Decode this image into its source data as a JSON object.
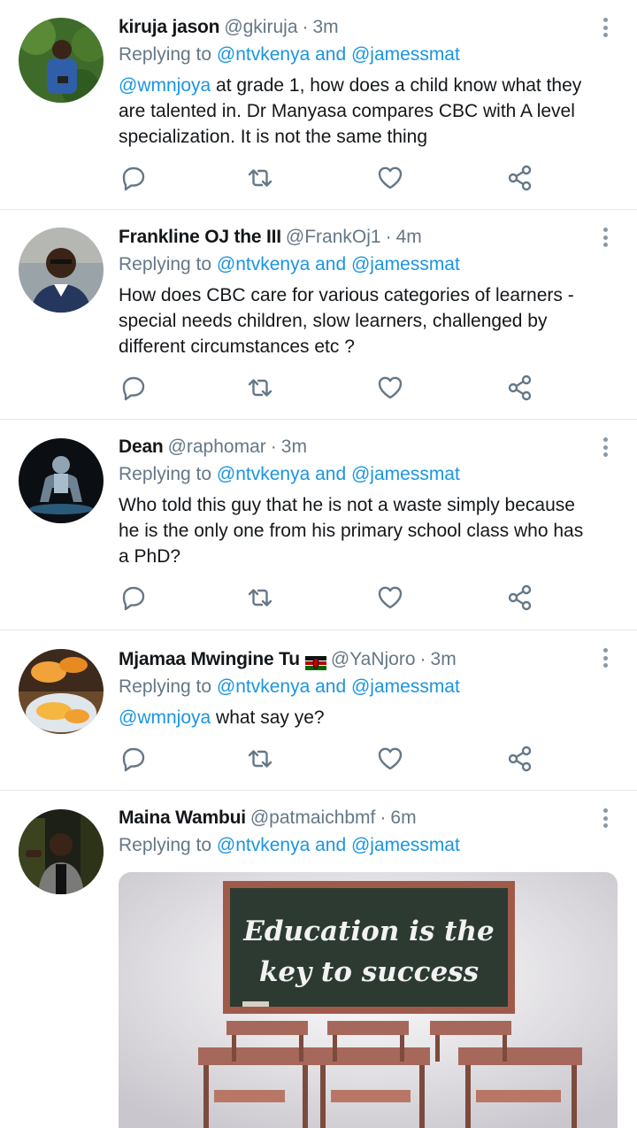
{
  "tweets": [
    {
      "name": "kiruja jason",
      "handle": "@gkiruja",
      "sep": "·",
      "time": "3m",
      "reply_prefix": "Replying to",
      "reply_users": "@ntvkenya and @jamessmat",
      "text_mention": "@wmnjoya",
      "text_lines": [
        "at grade 1, how does a child know what they",
        "are talented in. Dr Manyasa compares CBC with A level",
        "specialization. It is not the same thing"
      ]
    },
    {
      "name": "Frankline OJ the III",
      "handle": "@FrankOj1",
      "sep": "·",
      "time": "4m",
      "reply_prefix": "Replying to",
      "reply_users": "@ntvkenya and @jamessmat",
      "text_lines": [
        "How does CBC care for various categories of learners -",
        "special needs children, slow learners, challenged by",
        "different circumstances etc ?"
      ]
    },
    {
      "name": "Dean",
      "handle": "@raphomar",
      "sep": "·",
      "time": "3m",
      "reply_prefix": "Replying to",
      "reply_users": "@ntvkenya and @jamessmat",
      "text_lines": [
        "Who told this guy that he is not a waste simply because",
        "he is the only one from his primary school class who has",
        "a PhD?"
      ]
    },
    {
      "name": "Mjamaa Mwingine Tu",
      "handle": "@YaNjoro",
      "sep": "·",
      "time": "3m",
      "reply_prefix": "Replying to",
      "reply_users": "@ntvkenya and @jamessmat",
      "text_mention": "@wmnjoya",
      "text_lines": [
        "what say ye?"
      ],
      "flag": "kenya-flag-icon"
    },
    {
      "name": "Maina Wambui",
      "handle": "@patmaichbmf",
      "sep": "·",
      "time": "6m",
      "reply_prefix": "Replying to",
      "reply_users": "@ntvkenya and @jamessmat",
      "media": {
        "line1": "Education is the",
        "line2": "key to success"
      }
    }
  ],
  "icons": {
    "reply": "reply-icon",
    "retweet": "retweet-icon",
    "like": "heart-icon",
    "share": "share-icon",
    "more": "more-vertical-icon"
  },
  "colors": {
    "link": "#1b95e0",
    "secondary": "#657786",
    "icon": "#657786",
    "divider": "#e1e8ed"
  }
}
